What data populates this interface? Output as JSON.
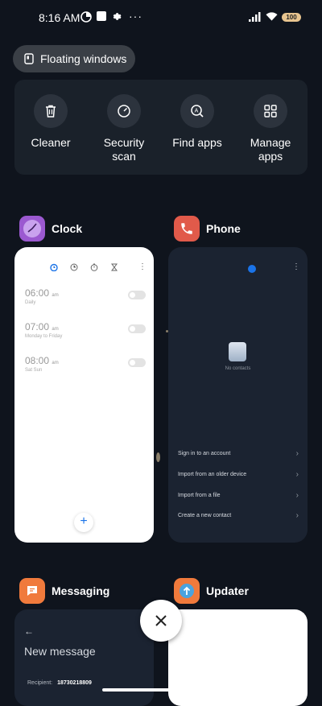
{
  "status": {
    "time": "8:16 AM",
    "battery": "100"
  },
  "floating": {
    "label": "Floating windows"
  },
  "quick_actions": [
    {
      "label": "Cleaner",
      "icon": "trash-icon"
    },
    {
      "label": "Security scan",
      "icon": "security-scan-icon"
    },
    {
      "label": "Find apps",
      "icon": "find-apps-icon"
    },
    {
      "label": "Manage apps",
      "icon": "grid-icon"
    }
  ],
  "apps": {
    "clock": {
      "name": "Clock",
      "alarms": [
        {
          "time": "06:00",
          "ampm": "am",
          "sub": "Daily"
        },
        {
          "time": "07:00",
          "ampm": "am",
          "sub": "Monday to Friday"
        },
        {
          "time": "08:00",
          "ampm": "am",
          "sub": "Sat Sun"
        }
      ],
      "add": "+"
    },
    "phone": {
      "name": "Phone",
      "no_contacts": "No contacts",
      "options": [
        "Sign in to an account",
        "Import from an older device",
        "Import from a file",
        "Create a new contact"
      ]
    },
    "messaging": {
      "name": "Messaging",
      "title": "New message",
      "recipient_label": "Recipient:",
      "recipient_value": "18730218809"
    },
    "updater": {
      "name": "Updater"
    }
  },
  "colors": {
    "clock_icon": "#9b59d0",
    "phone_icon": "#e15a4a",
    "messaging_icon": "#f07a3c",
    "updater_icon": "#f07a3c",
    "accent_blue": "#1a73e8"
  }
}
